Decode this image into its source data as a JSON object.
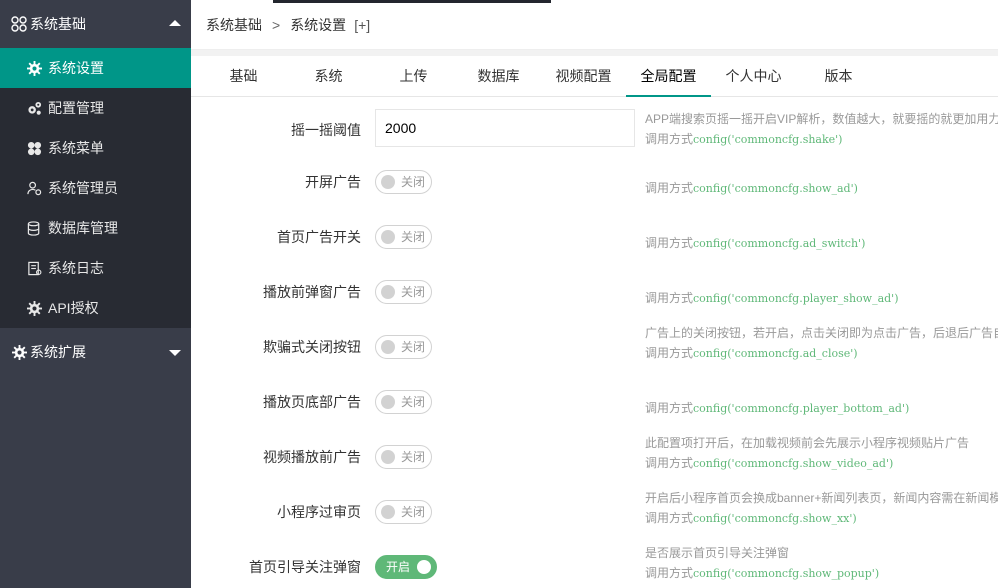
{
  "sidebar": {
    "group1": {
      "label": "系统基础",
      "icon": "apps-icon",
      "expanded": true
    },
    "items": [
      {
        "label": "系统设置",
        "icon": "gear-icon",
        "active": true
      },
      {
        "label": "配置管理",
        "icon": "gears-icon",
        "active": false
      },
      {
        "label": "系统菜单",
        "icon": "clover-icon",
        "active": false
      },
      {
        "label": "系统管理员",
        "icon": "user-gear-icon",
        "active": false
      },
      {
        "label": "数据库管理",
        "icon": "database-icon",
        "active": false
      },
      {
        "label": "系统日志",
        "icon": "log-icon",
        "active": false
      },
      {
        "label": "API授权",
        "icon": "gear-icon",
        "active": false
      }
    ],
    "group2": {
      "label": "系统扩展",
      "icon": "gear-icon",
      "expanded": false
    }
  },
  "breadcrumb": {
    "items": [
      "系统基础",
      "系统设置"
    ],
    "separator": ">",
    "extra": "[+]"
  },
  "tabs": [
    "基础",
    "系统",
    "上传",
    "数据库",
    "视频配置",
    "全局配置",
    "个人中心",
    "版本"
  ],
  "active_tab": 5,
  "call_prefix": "调用方式",
  "form": {
    "shake": {
      "label": "摇一摇阈值",
      "value": "2000",
      "help1": "APP端搜索页摇一摇开启VIP解析，数值越大，就要摇的就更加用力",
      "code": "config('commoncfg.shake')"
    },
    "switches": [
      {
        "label": "开屏广告",
        "state": "关闭",
        "on": false,
        "help1": "",
        "code": "config('commoncfg.show_ad')"
      },
      {
        "label": "首页广告开关",
        "state": "关闭",
        "on": false,
        "help1": "",
        "code": "config('commoncfg.ad_switch')"
      },
      {
        "label": "播放前弹窗广告",
        "state": "关闭",
        "on": false,
        "help1": "",
        "code": "config('commoncfg.player_show_ad')"
      },
      {
        "label": "欺骗式关闭按钮",
        "state": "关闭",
        "on": false,
        "help1": "广告上的关闭按钮，若开启，点击关闭即为点击广告，后退后广告自动关闭",
        "code": "config('commoncfg.ad_close')"
      },
      {
        "label": "播放页底部广告",
        "state": "关闭",
        "on": false,
        "help1": "",
        "code": "config('commoncfg.player_bottom_ad')"
      },
      {
        "label": "视频播放前广告",
        "state": "关闭",
        "on": false,
        "help1": "此配置项打开后，在加载视频前会先展示小程序视频贴片广告",
        "code": "config('commoncfg.show_video_ad')"
      },
      {
        "label": "小程序过审页",
        "state": "关闭",
        "on": false,
        "help1": "开启后小程序首页会换成banner+新闻列表页，新闻内容需在新闻模块添加",
        "code": "config('commoncfg.show_xx')"
      },
      {
        "label": "首页引导关注弹窗",
        "state": "开启",
        "on": true,
        "help1": "是否展示首页引导关注弹窗",
        "code": "config('commoncfg.show_popup')"
      }
    ]
  },
  "colors": {
    "sidebar_bg": "#393d49",
    "sidebar_sub_bg": "#282b33",
    "accent": "#009688",
    "switch_on": "#5fb878",
    "code_text": "#5fb878"
  }
}
